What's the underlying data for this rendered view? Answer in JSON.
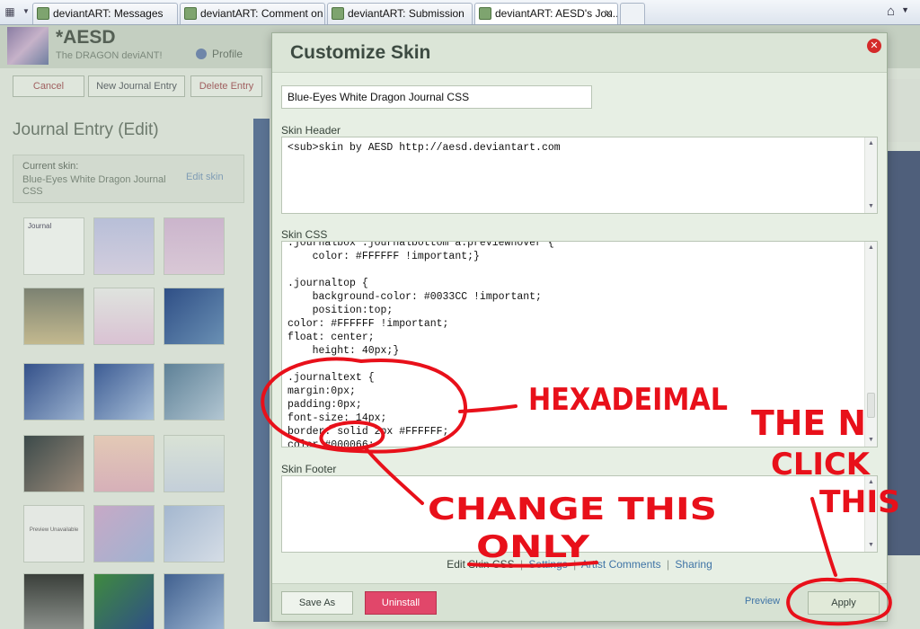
{
  "browser": {
    "tabs": [
      {
        "title": "deviantART: Messages",
        "active": false
      },
      {
        "title": "deviantART: Comment on ...",
        "active": false
      },
      {
        "title": "deviantART: Submission",
        "active": false
      },
      {
        "title": "deviantART: AESD's Jou...",
        "active": true
      }
    ],
    "close_glyph": "✕"
  },
  "background_page": {
    "username": "*AESD",
    "tagline": "The DRAGON deviANT!",
    "profile_link": "Profile",
    "buttons": [
      "Cancel",
      "New Journal Entry",
      "Delete Entry"
    ],
    "journal_title": "Journal Entry (Edit)",
    "current_skin_label": "Current skin:",
    "current_skin_name": "Blue-Eyes White Dragon Journal CSS",
    "edit_skin_link": "Edit skin",
    "thumb_journal_label": "Journal",
    "thumb_preview_text": "Preview Unavailable"
  },
  "modal": {
    "title": "Customize Skin",
    "skin_name_value": "Blue-Eyes White Dragon Journal CSS",
    "header_label": "Skin Header",
    "header_code": "<sub>skin by AESD http://aesd.deviantart.com",
    "css_label": "Skin CSS",
    "css_code": ".journalbox .journalbottom a:previewhover {\n    color: #FFFFFF !important;}\n\n.journaltop {\n    background-color: #0033CC !important;\n    position:top;\ncolor: #FFFFFF !important;\nfloat: center;\n    height: 40px;}\n\n.journaltext {\nmargin:0px;\npadding:0px;\nfont-size: 14px;\nborder: solid 2px #FFFFFF;\ncolor:#000066;",
    "footer_label": "Skin Footer",
    "footer_code": "",
    "bottom_links": {
      "edit_skin_css": "Edit Skin CSS",
      "settings": "Settings",
      "artist_comments": "Artist Comments",
      "sharing": "Sharing"
    },
    "buttons": {
      "save_as": "Save As",
      "uninstall": "Uninstall",
      "preview": "Preview",
      "apply": "Apply"
    }
  },
  "annotations": {
    "hexadecimal": "HEXADEIMAL",
    "change_this": "CHANGE THIS",
    "only": "ONLY",
    "then": "THE N",
    "click": "CLICK",
    "this": "THIS",
    "color": "#e8101a"
  }
}
